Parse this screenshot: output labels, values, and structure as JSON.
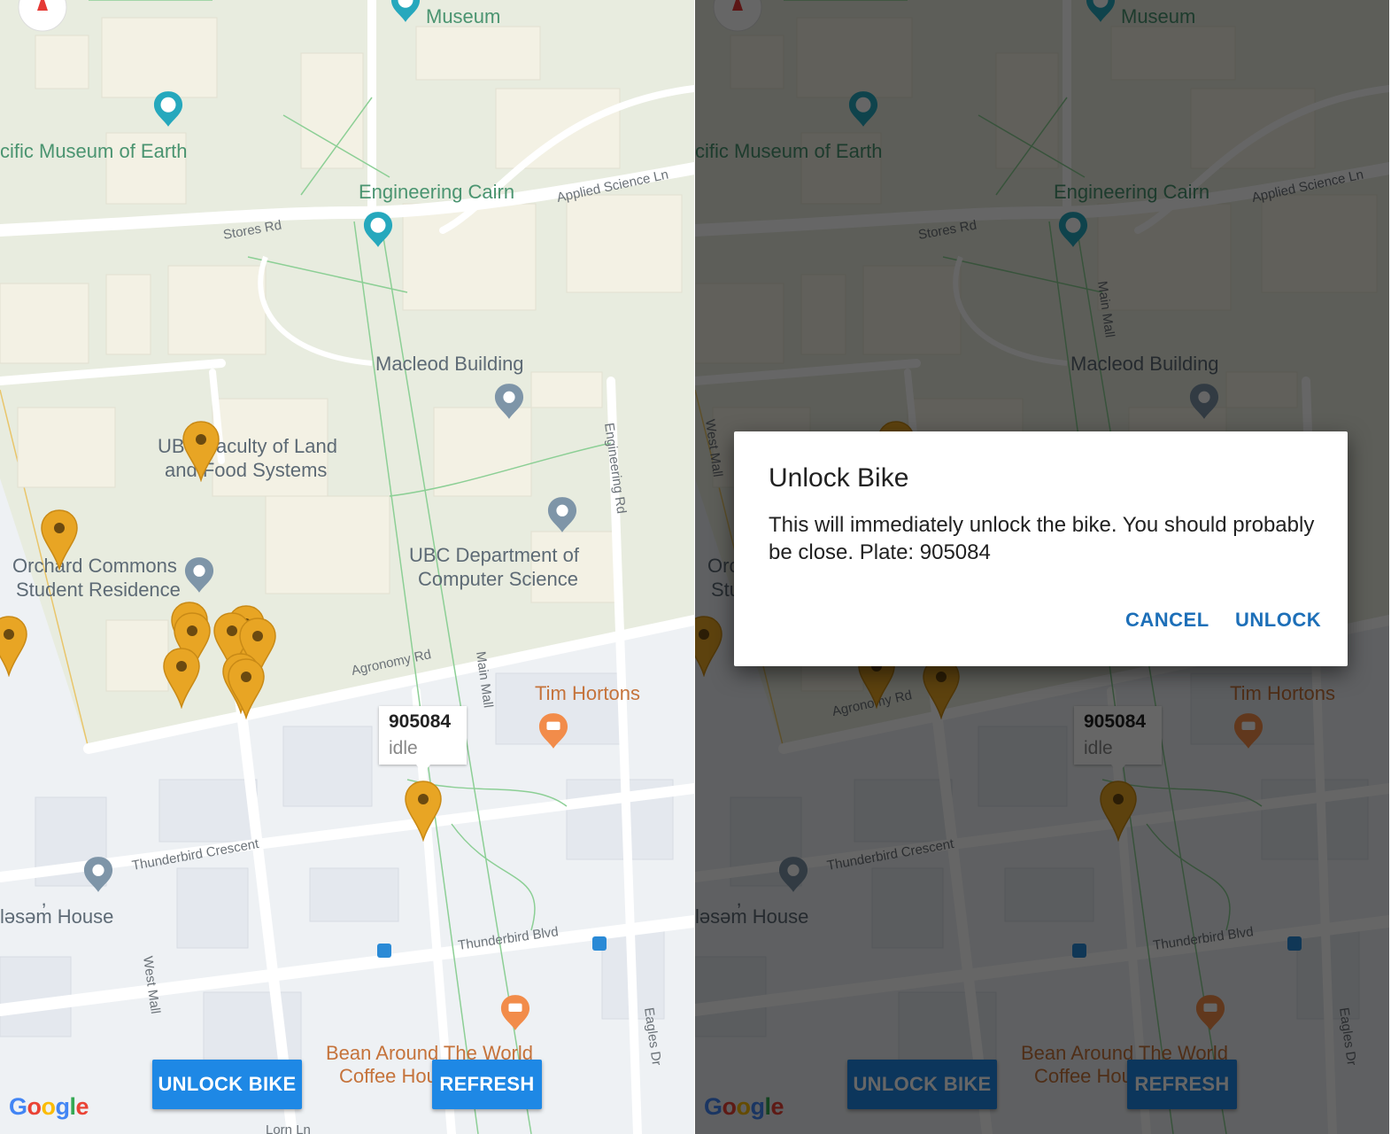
{
  "map": {
    "labels": {
      "museum_top": "Museum",
      "museum_earth": "cific Museum of Earth",
      "engineering_cairn": "Engineering Cairn",
      "applied_science_ln": "Applied Science Ln",
      "stores_rd": "Stores Rd",
      "macleod_building": "Macleod Building",
      "faculty_line1": "UBC Faculty of Land",
      "faculty_line2": "and Food Systems",
      "engineering_rd": "Engineering Rd",
      "orchard_line1": "Orchard Commons",
      "orchard_line2": "Student Residence",
      "ubc_cs_line1": "UBC Department of",
      "ubc_cs_line2": "Computer Science",
      "agronomy_rd": "Agronomy Rd",
      "main_mall": "Main Mall",
      "tim_hortons": "Tim Hortons",
      "thunderbird_crescent": "Thunderbird Crescent",
      "house": "ləsəm̓ House",
      "thunderbird_blvd": "Thunderbird Blvd",
      "west_mall": "West Mall",
      "eagles_dr": "Eagles Dr",
      "bean_line1": "Bean Around The World",
      "bean_line2": "Coffee House",
      "bottom_road": "Lorn Ln"
    },
    "info_window": {
      "plate": "905084",
      "status": "idle"
    },
    "colors": {
      "marker": "#e8a524",
      "building": "#f0efe6",
      "campus": "#e8ecdf",
      "road": "#ffffff",
      "path": "#8ccf95",
      "boundary": "#e9c56a"
    }
  },
  "buttons": {
    "unlock_bike": "UNLOCK BIKE",
    "refresh": "REFRESH"
  },
  "google": {
    "g1": "G",
    "o1": "o",
    "o2": "o",
    "g2": "g",
    "l": "l",
    "e": "e"
  },
  "dialog": {
    "title": "Unlock Bike",
    "message": "This will immediately unlock the bike. You should probably be close. Plate: 905084",
    "cancel": "CANCEL",
    "unlock": "UNLOCK"
  }
}
